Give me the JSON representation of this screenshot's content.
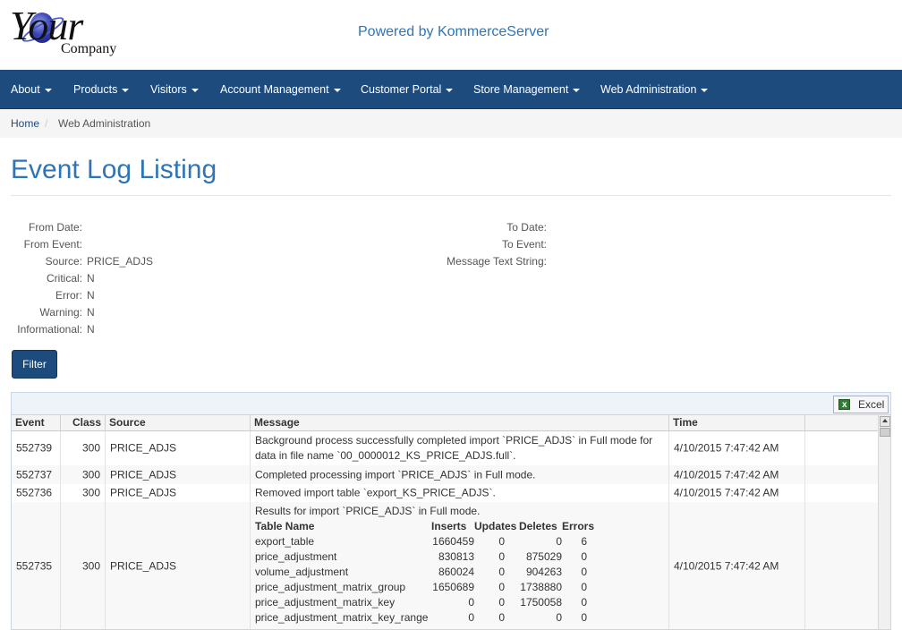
{
  "header": {
    "logo_text_main": "Your",
    "logo_text_sub": "Company",
    "powered_by": "Powered by KommerceServer"
  },
  "nav": {
    "items": [
      {
        "label": "About"
      },
      {
        "label": "Products"
      },
      {
        "label": "Visitors"
      },
      {
        "label": "Account Management"
      },
      {
        "label": "Customer Portal"
      },
      {
        "label": "Store Management"
      },
      {
        "label": "Web Administration"
      }
    ]
  },
  "breadcrumb": {
    "home": "Home",
    "separator": "/",
    "current": "Web Administration"
  },
  "page": {
    "title": "Event Log Listing"
  },
  "filters": {
    "from_date_label": "From Date:",
    "from_date_value": "",
    "from_event_label": "From Event:",
    "from_event_value": "",
    "source_label": "Source:",
    "source_value": "PRICE_ADJS",
    "critical_label": "Critical:",
    "critical_value": "N",
    "error_label": "Error:",
    "error_value": "N",
    "warning_label": "Warning:",
    "warning_value": "N",
    "informational_label": "Informational:",
    "informational_value": "N",
    "to_date_label": "To Date:",
    "to_date_value": "",
    "to_event_label": "To Event:",
    "to_event_value": "",
    "message_text_label": "Message Text String:",
    "message_text_value": "",
    "filter_button": "Filter"
  },
  "grid": {
    "excel_label": "Excel",
    "columns": {
      "event": "Event",
      "class": "Class",
      "source": "Source",
      "message": "Message",
      "time": "Time"
    },
    "rows": [
      {
        "event": "552739",
        "class": "300",
        "source": "PRICE_ADJS",
        "message": "Background process successfully completed import `PRICE_ADJS` in Full mode for data in file name `00_0000012_KS_PRICE_ADJS.full`.",
        "time": "4/10/2015 7:47:42 AM"
      },
      {
        "event": "552737",
        "class": "300",
        "source": "PRICE_ADJS",
        "message": "Completed processing import `PRICE_ADJS` in Full mode.",
        "time": "4/10/2015 7:47:42 AM"
      },
      {
        "event": "552736",
        "class": "300",
        "source": "PRICE_ADJS",
        "message": "Removed import table `export_KS_PRICE_ADJS`.",
        "time": "4/10/2015 7:47:42 AM"
      },
      {
        "event": "552735",
        "class": "300",
        "source": "PRICE_ADJS",
        "message": "Results for import `PRICE_ADJS` in Full mode.",
        "time": "4/10/2015 7:47:42 AM",
        "results_header": {
          "table_name": "Table Name",
          "inserts": "Inserts",
          "updates": "Updates",
          "deletes": "Deletes",
          "errors": "Errors"
        },
        "results": [
          {
            "table_name": "export_table",
            "inserts": "1660459",
            "updates": "0",
            "deletes": "0",
            "errors": "6"
          },
          {
            "table_name": "price_adjustment",
            "inserts": "830813",
            "updates": "0",
            "deletes": "875029",
            "errors": "0"
          },
          {
            "table_name": "volume_adjustment",
            "inserts": "860024",
            "updates": "0",
            "deletes": "904263",
            "errors": "0"
          },
          {
            "table_name": "price_adjustment_matrix_group",
            "inserts": "1650689",
            "updates": "0",
            "deletes": "1738880",
            "errors": "0"
          },
          {
            "table_name": "price_adjustment_matrix_key",
            "inserts": "0",
            "updates": "0",
            "deletes": "1750058",
            "errors": "0"
          },
          {
            "table_name": "price_adjustment_matrix_key_range",
            "inserts": "0",
            "updates": "0",
            "deletes": "0",
            "errors": "0"
          }
        ]
      }
    ]
  }
}
